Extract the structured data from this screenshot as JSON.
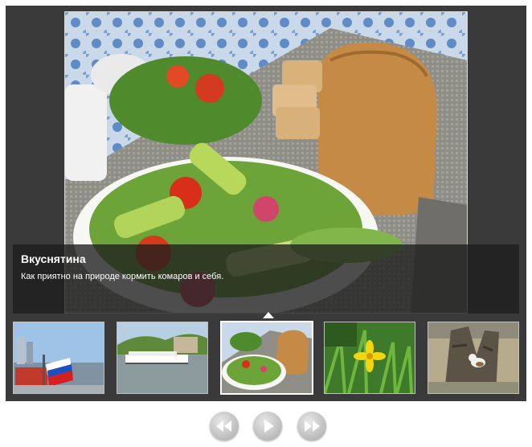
{
  "caption": {
    "title": "Вкуснятина",
    "text": "Как приятно на природе кормить комаров и себя."
  },
  "thumbnails": [
    {
      "subject": "waterfront with flag",
      "active": false
    },
    {
      "subject": "river boat",
      "active": false
    },
    {
      "subject": "salad and bread",
      "active": true
    },
    {
      "subject": "yellow flower",
      "active": false
    },
    {
      "subject": "tree stump with cat",
      "active": false
    }
  ],
  "controls": {
    "prev_icon": "rewind-icon",
    "play_icon": "play-icon",
    "next_icon": "fast-forward-icon"
  },
  "colors": {
    "frame_bg": "#3a3a3a",
    "caption_bg": "rgba(30,30,30,0.78)",
    "button_gray": "#c4c4c4"
  }
}
